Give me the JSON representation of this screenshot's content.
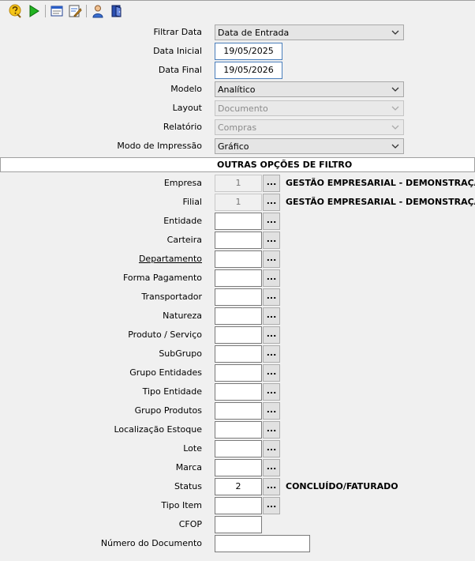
{
  "toolbar": {
    "buttons": [
      {
        "icon": "help-icon"
      },
      {
        "icon": "play-icon"
      },
      {
        "icon": "window-icon"
      },
      {
        "icon": "edit-report-icon"
      },
      {
        "icon": "user-icon"
      },
      {
        "icon": "exit-door-icon"
      }
    ]
  },
  "filters": {
    "filtrar_data": {
      "label": "Filtrar Data",
      "value": "Data de Entrada"
    },
    "data_inicial": {
      "label": "Data Inicial",
      "value": "19/05/2025"
    },
    "data_final": {
      "label": "Data Final",
      "value": "19/05/2026"
    },
    "modelo": {
      "label": "Modelo",
      "value": "Analítico"
    },
    "layout": {
      "label": "Layout",
      "value": "Documento"
    },
    "relatorio": {
      "label": "Relatório",
      "value": "Compras"
    },
    "modo_impressao": {
      "label": "Modo de Impressão",
      "value": "Gráfico"
    }
  },
  "section_title": "OUTRAS OPÇÕES DE FILTRO",
  "lookup_button_label": "...",
  "fields": [
    {
      "label": "Empresa",
      "value": "1",
      "desc": "GESTÃO EMPRESARIAL - DEMONSTRAÇÃO"
    },
    {
      "label": "Filial",
      "value": "1",
      "desc": "GESTÃO EMPRESARIAL - DEMONSTRAÇÃO"
    },
    {
      "label": "Entidade",
      "value": "",
      "desc": ""
    },
    {
      "label": "Carteira",
      "value": "",
      "desc": ""
    },
    {
      "label": "Departamento",
      "value": "",
      "desc": ""
    },
    {
      "label": "Forma Pagamento",
      "value": "",
      "desc": ""
    },
    {
      "label": "Transportador",
      "value": "",
      "desc": ""
    },
    {
      "label": "Natureza",
      "value": "",
      "desc": ""
    },
    {
      "label": "Produto / Serviço",
      "value": "",
      "desc": ""
    },
    {
      "label": "SubGrupo",
      "value": "",
      "desc": ""
    },
    {
      "label": "Grupo Entidades",
      "value": "",
      "desc": ""
    },
    {
      "label": "Tipo Entidade",
      "value": "",
      "desc": ""
    },
    {
      "label": "Grupo Produtos",
      "value": "",
      "desc": ""
    },
    {
      "label": "Localização Estoque",
      "value": "",
      "desc": ""
    },
    {
      "label": "Lote",
      "value": "",
      "desc": ""
    },
    {
      "label": "Marca",
      "value": "",
      "desc": ""
    },
    {
      "label": "Status",
      "value": "2",
      "desc": "CONCLUÍDO/FATURADO"
    },
    {
      "label": "Tipo Item",
      "value": "",
      "desc": ""
    },
    {
      "label": "CFOP",
      "value": ""
    },
    {
      "label": "Número do Documento",
      "value": ""
    }
  ]
}
